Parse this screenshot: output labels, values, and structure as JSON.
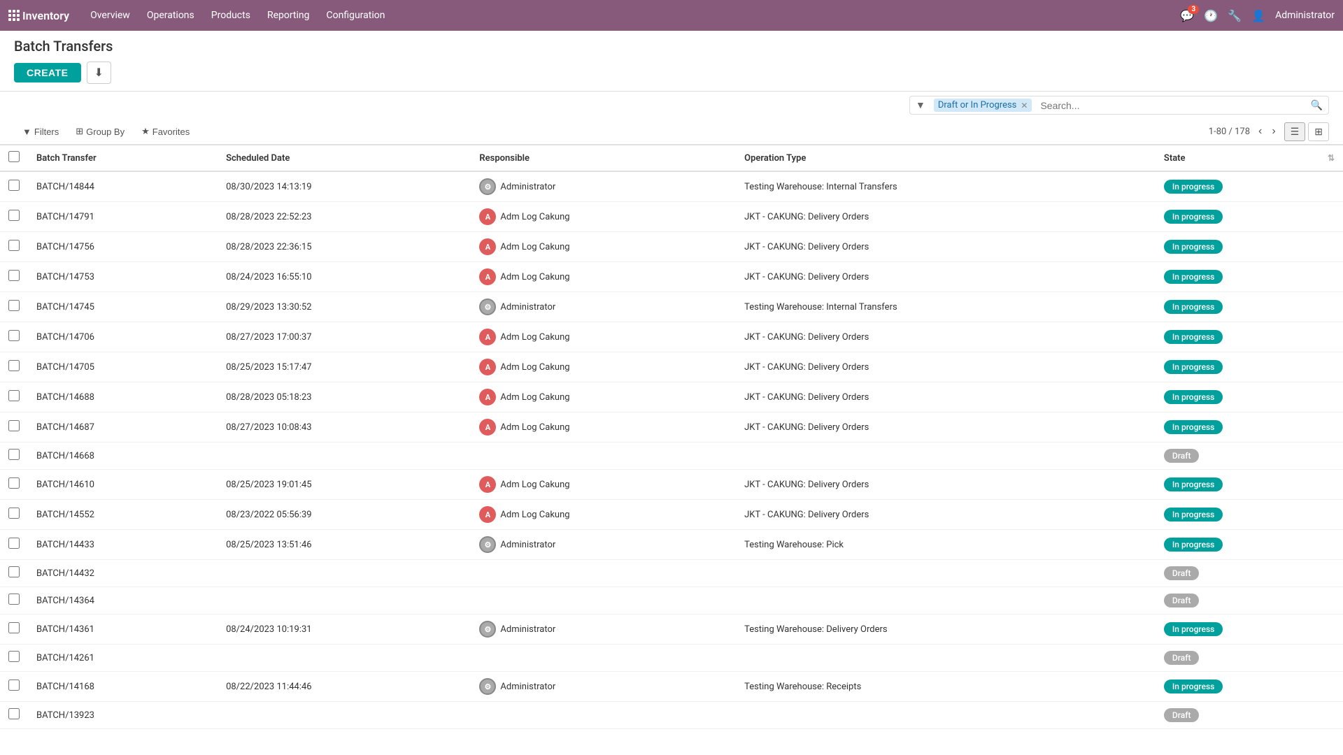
{
  "app": {
    "name": "Inventory",
    "nav_items": [
      "Overview",
      "Operations",
      "Products",
      "Reporting",
      "Configuration"
    ],
    "badge_count": "3",
    "user": "Administrator"
  },
  "page": {
    "title": "Batch Transfers",
    "create_label": "CREATE"
  },
  "search": {
    "filter_tag": "Draft or In Progress",
    "placeholder": "Search...",
    "pagination": "1-80 / 178"
  },
  "filter_buttons": [
    {
      "label": "Filters",
      "icon": "▾"
    },
    {
      "label": "Group By",
      "icon": "▾"
    },
    {
      "label": "Favorites",
      "icon": "▾"
    }
  ],
  "table": {
    "columns": [
      "Batch Transfer",
      "Scheduled Date",
      "Responsible",
      "Operation Type",
      "State"
    ],
    "rows": [
      {
        "id": "BATCH/14844",
        "date": "08/30/2023 14:13:19",
        "responsible": "Administrator",
        "avatar_type": "admin",
        "operation": "Testing Warehouse: Internal Transfers",
        "state": "In progress"
      },
      {
        "id": "BATCH/14791",
        "date": "08/28/2023 22:52:23",
        "responsible": "Adm Log Cakung",
        "avatar_type": "adm",
        "operation": "JKT - CAKUNG: Delivery Orders",
        "state": "In progress"
      },
      {
        "id": "BATCH/14756",
        "date": "08/28/2023 22:36:15",
        "responsible": "Adm Log Cakung",
        "avatar_type": "adm",
        "operation": "JKT - CAKUNG: Delivery Orders",
        "state": "In progress"
      },
      {
        "id": "BATCH/14753",
        "date": "08/24/2023 16:55:10",
        "responsible": "Adm Log Cakung",
        "avatar_type": "adm",
        "operation": "JKT - CAKUNG: Delivery Orders",
        "state": "In progress"
      },
      {
        "id": "BATCH/14745",
        "date": "08/29/2023 13:30:52",
        "responsible": "Administrator",
        "avatar_type": "admin",
        "operation": "Testing Warehouse: Internal Transfers",
        "state": "In progress"
      },
      {
        "id": "BATCH/14706",
        "date": "08/27/2023 17:00:37",
        "responsible": "Adm Log Cakung",
        "avatar_type": "adm",
        "operation": "JKT - CAKUNG: Delivery Orders",
        "state": "In progress"
      },
      {
        "id": "BATCH/14705",
        "date": "08/25/2023 15:17:47",
        "responsible": "Adm Log Cakung",
        "avatar_type": "adm",
        "operation": "JKT - CAKUNG: Delivery Orders",
        "state": "In progress"
      },
      {
        "id": "BATCH/14688",
        "date": "08/28/2023 05:18:23",
        "responsible": "Adm Log Cakung",
        "avatar_type": "adm",
        "operation": "JKT - CAKUNG: Delivery Orders",
        "state": "In progress"
      },
      {
        "id": "BATCH/14687",
        "date": "08/27/2023 10:08:43",
        "responsible": "Adm Log Cakung",
        "avatar_type": "adm",
        "operation": "JKT - CAKUNG: Delivery Orders",
        "state": "In progress"
      },
      {
        "id": "BATCH/14668",
        "date": "",
        "responsible": "",
        "avatar_type": "",
        "operation": "",
        "state": "Draft"
      },
      {
        "id": "BATCH/14610",
        "date": "08/25/2023 19:01:45",
        "responsible": "Adm Log Cakung",
        "avatar_type": "adm",
        "operation": "JKT - CAKUNG: Delivery Orders",
        "state": "In progress"
      },
      {
        "id": "BATCH/14552",
        "date": "08/23/2022 05:56:39",
        "responsible": "Adm Log Cakung",
        "avatar_type": "adm",
        "operation": "JKT - CAKUNG: Delivery Orders",
        "state": "In progress"
      },
      {
        "id": "BATCH/14433",
        "date": "08/25/2023 13:51:46",
        "responsible": "Administrator",
        "avatar_type": "admin",
        "operation": "Testing Warehouse: Pick",
        "state": "In progress"
      },
      {
        "id": "BATCH/14432",
        "date": "",
        "responsible": "",
        "avatar_type": "",
        "operation": "",
        "state": "Draft"
      },
      {
        "id": "BATCH/14364",
        "date": "",
        "responsible": "",
        "avatar_type": "",
        "operation": "",
        "state": "Draft"
      },
      {
        "id": "BATCH/14361",
        "date": "08/24/2023 10:19:31",
        "responsible": "Administrator",
        "avatar_type": "admin",
        "operation": "Testing Warehouse: Delivery Orders",
        "state": "In progress"
      },
      {
        "id": "BATCH/14261",
        "date": "",
        "responsible": "",
        "avatar_type": "",
        "operation": "",
        "state": "Draft"
      },
      {
        "id": "BATCH/14168",
        "date": "08/22/2023 11:44:46",
        "responsible": "Administrator",
        "avatar_type": "admin",
        "operation": "Testing Warehouse: Receipts",
        "state": "In progress"
      },
      {
        "id": "BATCH/13923",
        "date": "",
        "responsible": "",
        "avatar_type": "",
        "operation": "",
        "state": "Draft"
      }
    ]
  }
}
